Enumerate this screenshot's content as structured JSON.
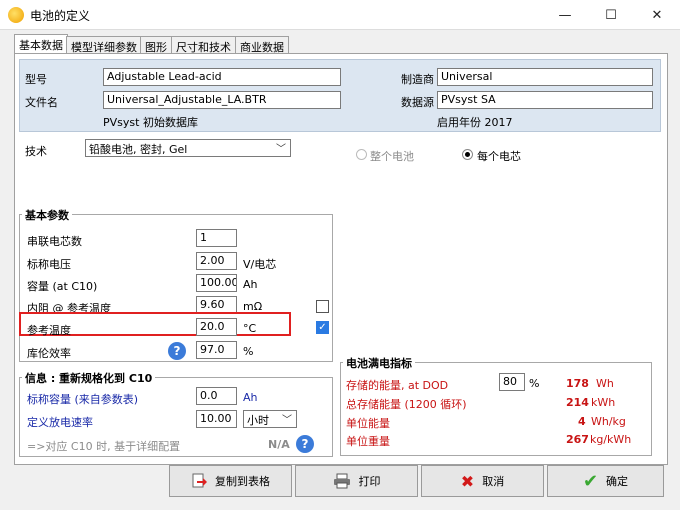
{
  "window": {
    "title": "电池的定义",
    "minimize": "—",
    "maximize": "☐",
    "close": "✕"
  },
  "tabs": [
    "基本数据",
    "模型详细参数",
    "图形",
    "尺寸和技术",
    "商业数据"
  ],
  "header": {
    "model_label": "型号",
    "model_value": "Adjustable Lead-acid",
    "file_label": "文件名",
    "file_value": "Universal_Adjustable_LA.BTR",
    "db_note": "PVsyst 初始数据库",
    "manufacturer_label": "制造商",
    "manufacturer_value": "Universal",
    "source_label": "数据源",
    "source_value": "PVsyst SA",
    "year_note": "启用年份 2017"
  },
  "technology": {
    "label": "技术",
    "value": "铅酸电池, 密封, Gel",
    "radio_whole": "整个电池",
    "radio_cell": "每个电芯"
  },
  "basic_params": {
    "title": "基本参数",
    "rows": [
      {
        "label": "串联电芯数",
        "value": "1",
        "unit": ""
      },
      {
        "label": "标称电压",
        "value": "2.00",
        "unit": "V/电芯"
      },
      {
        "label": "容量 (at C10)",
        "value": "100.00",
        "unit": "Ah"
      },
      {
        "label": "内阻 @ 参考温度",
        "value": "9.60",
        "unit": "mΩ"
      },
      {
        "label": "参考温度",
        "value": "20.0",
        "unit": "°C"
      },
      {
        "label": "库伦效率",
        "value": "97.0",
        "unit": "%"
      }
    ]
  },
  "info": {
    "title": "信息 : 重新规格化到 C10",
    "nominal_label": "标称容量 (来自参数表)",
    "nominal_value": "0.0",
    "nominal_unit": "Ah",
    "rate_label": "定义放电速率",
    "rate_value": "10.00",
    "rate_unit": "小时",
    "note": "=>对应 C10 时, 基于详细配置",
    "na": "N/A"
  },
  "indicators": {
    "title": "电池满电指标",
    "stored_label": "存储的能量, at DOD",
    "dod_value": "80",
    "dod_unit": "%",
    "stored_value": "178",
    "stored_unit": "Wh",
    "total_label": "总存储能量 (1200 循环)",
    "total_value": "214",
    "total_unit": "kWh",
    "unit_energy_label": "单位能量",
    "unit_energy_value": "4",
    "unit_energy_unit": "Wh/kg",
    "unit_weight_label": "单位重量",
    "unit_weight_value": "267",
    "unit_weight_unit": "kg/kWh"
  },
  "buttons": {
    "copy": "复制到表格",
    "print": "打印",
    "cancel": "取消",
    "ok": "确定"
  }
}
